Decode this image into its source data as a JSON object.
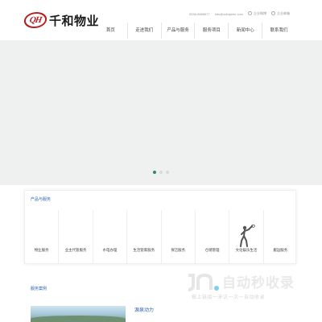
{
  "header": {
    "logo_mark": "QH",
    "logo_text": "千和物业",
    "phone": "0536-8668677",
    "email": "info@sdhqwhe.com",
    "link_wechat": "企业微博",
    "link_mail": "企业邮箱"
  },
  "nav": {
    "items": [
      {
        "label": "首页"
      },
      {
        "label": "走进我们"
      },
      {
        "label": "产品与服务"
      },
      {
        "label": "服务项目"
      },
      {
        "label": "新闻中心"
      },
      {
        "label": "联系我们"
      }
    ]
  },
  "banner": {
    "slide_count": 3,
    "active_index": 0
  },
  "services": {
    "title": "产品与服务",
    "items": [
      {
        "label": "物业服务"
      },
      {
        "label": "业主代管服务"
      },
      {
        "label": "水电办理"
      },
      {
        "label": "生活管家服务"
      },
      {
        "label": "保洁服务"
      },
      {
        "label": "仓储管理"
      },
      {
        "label": "文化娱乐生活",
        "icon": "tennis-player-icon"
      },
      {
        "label": "搬运服务"
      }
    ]
  },
  "cases": {
    "title": "服务案例",
    "item_title": "源泉动力"
  },
  "watermark": {
    "text": "自动秒收录",
    "sub": "做上链接一来访一次一自动收录"
  },
  "colors": {
    "brand_red": "#b22222",
    "accent_blue": "#2a5fb0",
    "active_dot": "#2e8b57"
  }
}
